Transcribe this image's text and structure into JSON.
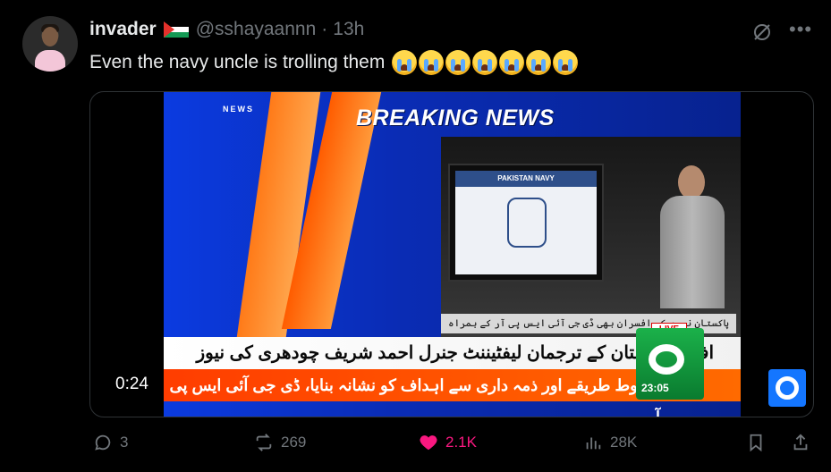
{
  "post": {
    "display_name": "invader",
    "handle": "@sshayaannn",
    "separator": "·",
    "time": "13h",
    "text": "Even the navy uncle is trolling them",
    "emoji_count": 7
  },
  "video": {
    "duration": "0:24",
    "news_tag": "NEWS",
    "breaking": "BREAKING NEWS",
    "monitor_title": "PAKISTAN NAVY",
    "live": "LIVE",
    "upper_strip": "پاکستان نیوی کے افسران بھی ڈی جی آئی ایس پی آر کے ہمراہ",
    "headline": "افواج پاکستان کے ترجمان لیفٹیننٹ جنرل احمد شریف چودھری کی نیوز کانفرنس",
    "ticker": "مربوط طریقے اور ذمہ داری سے اہداف کو نشانہ بنایا، ڈی جی آئی ایس پی آر",
    "clock": "23:05"
  },
  "actions": {
    "replies": "3",
    "reposts": "269",
    "likes": "2.1K",
    "views": "28K"
  },
  "colors": {
    "like": "#f91880",
    "muted": "#71767b"
  }
}
